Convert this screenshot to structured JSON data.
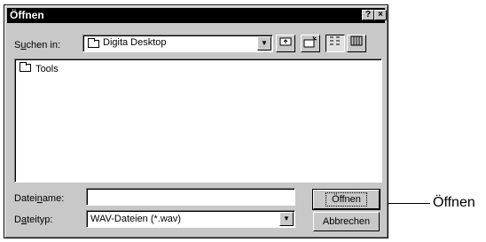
{
  "window": {
    "title": "Öffnen",
    "help_glyph": "?",
    "close_glyph": "×"
  },
  "look_in": {
    "label_pre": "S",
    "label_u": "u",
    "label_post": "chen in:",
    "value": "Digita Desktop"
  },
  "file_list": {
    "items": [
      {
        "name": "Tools",
        "icon": "folder-icon"
      }
    ]
  },
  "filename": {
    "label_pre": "Datei",
    "label_u": "n",
    "label_post": "ame:",
    "value": ""
  },
  "filetype": {
    "label_pre": "D",
    "label_u": "a",
    "label_post": "teityp:",
    "value": "WAV-Dateien (*.wav)"
  },
  "buttons": {
    "open_label": "Öffnen",
    "cancel_label": "Abbrechen"
  },
  "callout": {
    "text": "Öffnen"
  },
  "icons": {
    "up_folder": "up-folder-icon",
    "new_folder": "new-folder-icon",
    "list_view": "list-view-icon",
    "details_view": "details-view-icon"
  }
}
